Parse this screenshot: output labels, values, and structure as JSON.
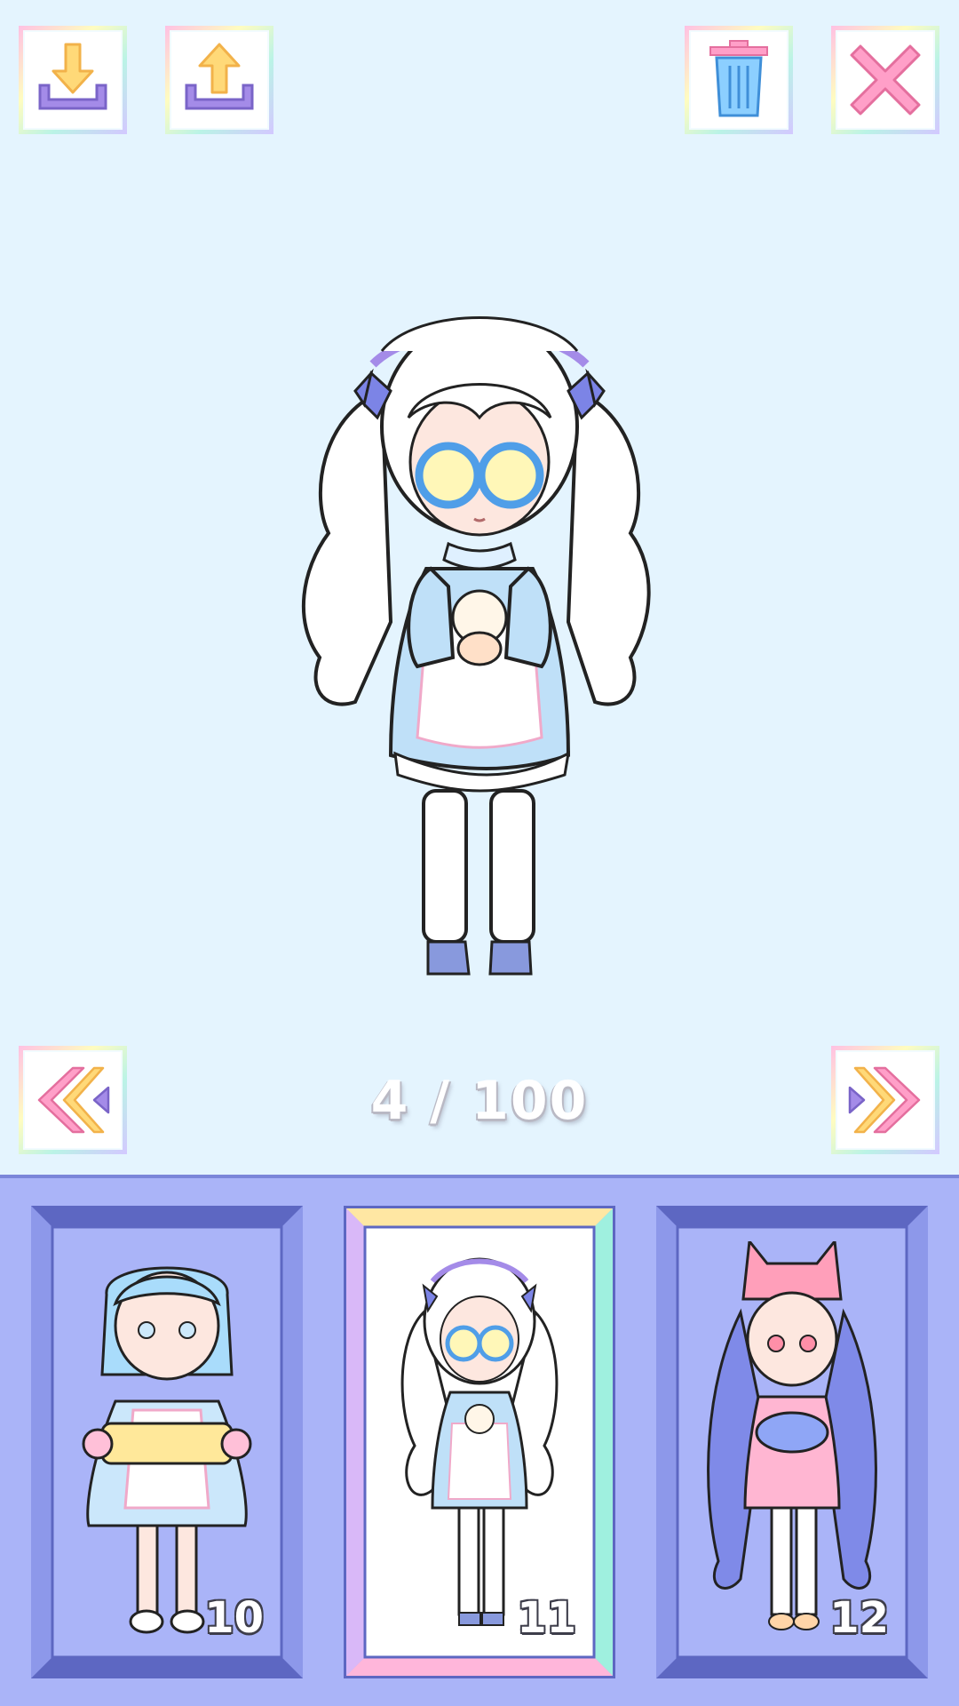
{
  "toolbar": {
    "download_icon": "download-arrow-icon",
    "upload_icon": "upload-arrow-icon",
    "delete_icon": "trash-icon",
    "close_icon": "close-x-icon"
  },
  "navigation": {
    "prev_icon": "double-chevron-left-icon",
    "next_icon": "double-chevron-right-icon",
    "counter_text": "4 / 100"
  },
  "character_tray": {
    "cards": [
      {
        "label": "10",
        "selected": false
      },
      {
        "label": "11",
        "selected": true
      },
      {
        "label": "12",
        "selected": false
      }
    ]
  },
  "colors": {
    "background": "#e4f4fe",
    "tray": "#aab4f8",
    "card_frame": "#6470c8",
    "arrow_yellow": "#ffd978",
    "tray_purple": "#a48be8",
    "trash_blue": "#8ccfff",
    "close_pink": "#ff9fc8"
  }
}
